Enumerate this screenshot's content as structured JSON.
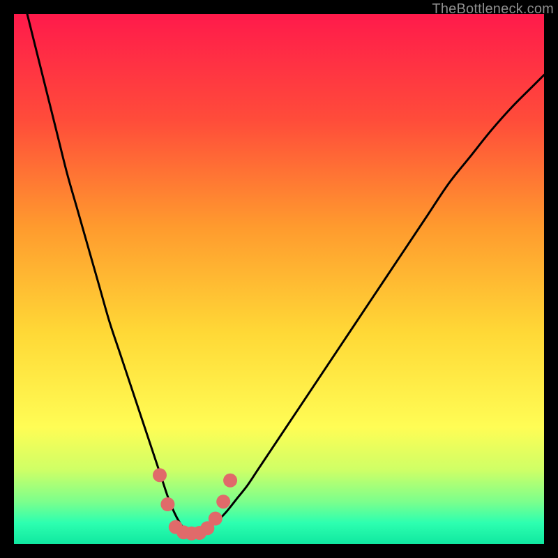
{
  "watermark": "TheBottleneck.com",
  "chart_data": {
    "type": "line",
    "title": "",
    "xlabel": "",
    "ylabel": "",
    "xlim": [
      0,
      100
    ],
    "ylim": [
      0,
      100
    ],
    "background_gradient": {
      "stops": [
        {
          "offset": 0.0,
          "color": "#ff1a4b"
        },
        {
          "offset": 0.2,
          "color": "#ff4c3a"
        },
        {
          "offset": 0.4,
          "color": "#ff9a2e"
        },
        {
          "offset": 0.6,
          "color": "#ffd836"
        },
        {
          "offset": 0.78,
          "color": "#fffd55"
        },
        {
          "offset": 0.86,
          "color": "#cfff66"
        },
        {
          "offset": 0.92,
          "color": "#7cff8c"
        },
        {
          "offset": 0.96,
          "color": "#2dffb0"
        },
        {
          "offset": 1.0,
          "color": "#10e8a0"
        }
      ]
    },
    "series": [
      {
        "name": "curve",
        "color": "#000000",
        "x": [
          0,
          2,
          4,
          6,
          8,
          10,
          12,
          14,
          16,
          18,
          20,
          22,
          24,
          26,
          27,
          28,
          29,
          30,
          31,
          32,
          33,
          34,
          35,
          36,
          38,
          40,
          42,
          44,
          46,
          48,
          50,
          54,
          58,
          62,
          66,
          70,
          74,
          78,
          82,
          86,
          90,
          94,
          98,
          100
        ],
        "y": [
          110,
          102,
          94,
          86,
          78,
          70,
          63,
          56,
          49,
          42,
          36,
          30,
          24,
          18,
          15,
          12,
          9,
          6.5,
          4.5,
          3,
          2.2,
          2,
          2.1,
          2.6,
          4,
          6,
          8.5,
          11,
          14,
          17,
          20,
          26,
          32,
          38,
          44,
          50,
          56,
          62,
          68,
          73,
          78,
          82.5,
          86.5,
          88.5
        ]
      }
    ],
    "markers": {
      "name": "highlight-dots",
      "color": "#e06a6a",
      "radius": 10,
      "points": [
        {
          "x": 27.5,
          "y": 13
        },
        {
          "x": 29.0,
          "y": 7.5
        },
        {
          "x": 30.5,
          "y": 3.2
        },
        {
          "x": 32.0,
          "y": 2.2
        },
        {
          "x": 33.5,
          "y": 2.0
        },
        {
          "x": 35.0,
          "y": 2.1
        },
        {
          "x": 36.5,
          "y": 3.0
        },
        {
          "x": 38.0,
          "y": 4.8
        },
        {
          "x": 39.5,
          "y": 8.0
        },
        {
          "x": 40.8,
          "y": 12.0
        }
      ]
    }
  }
}
